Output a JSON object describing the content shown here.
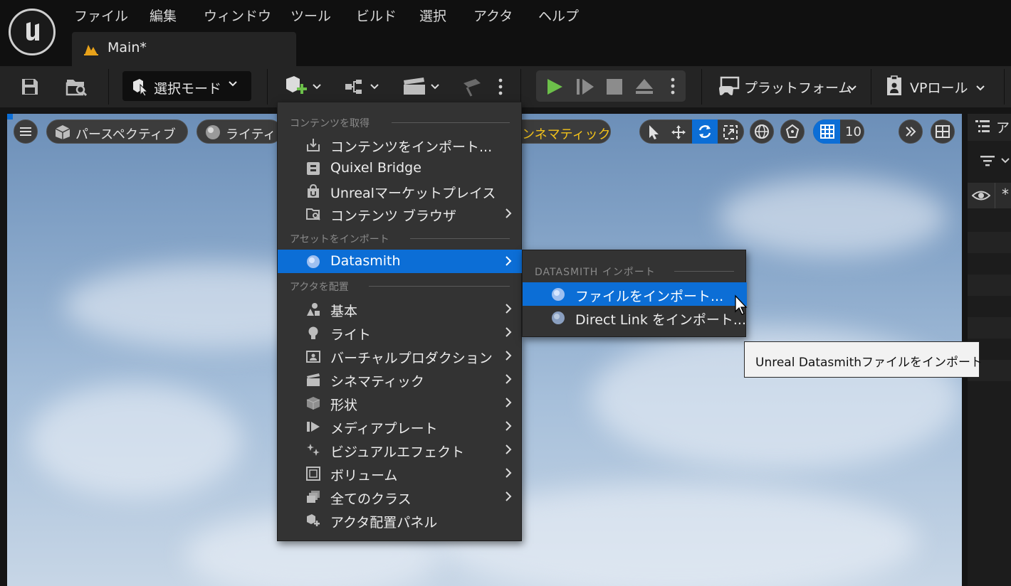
{
  "menubar": {
    "items": [
      "ファイル",
      "編集",
      "ウィンドウ",
      "ツール",
      "ビルド",
      "選択",
      "アクタ",
      "ヘルプ"
    ]
  },
  "document_tab": {
    "label": "Main*"
  },
  "toolbar": {
    "mode_label": "選択モード",
    "platform_label": "プラットフォーム",
    "vp_role_label": "VPロール"
  },
  "viewport": {
    "perspective_label": "パースペクティブ",
    "lighting_label": "ライティ",
    "cinematic_label": "ンネマティック",
    "grid_value": "10"
  },
  "outliner": {
    "header_label": "ア"
  },
  "add_menu": {
    "section_get_content": "コンテンツを取得",
    "import_content": "コンテンツをインポート...",
    "quixel_bridge": "Quixel Bridge",
    "marketplace": "Unrealマーケットプレイス",
    "content_browser": "コンテンツ ブラウザ",
    "section_import_asset": "アセットをインポート",
    "datasmith": "Datasmith",
    "section_place_actor": "アクタを配置",
    "basic": "基本",
    "lights": "ライト",
    "virtual_production": "バーチャルプロダクション",
    "cinematic": "シネマティック",
    "shapes": "形状",
    "media_plate": "メディアプレート",
    "visual_effects": "ビジュアルエフェクト",
    "volumes": "ボリューム",
    "all_classes": "全てのクラス",
    "place_actors_panel": "アクタ配置パネル"
  },
  "datasmith_submenu": {
    "section": "DATASMITH インポート",
    "import_file": "ファイルをインポート...",
    "import_direct_link": "Direct Link をインポート..."
  },
  "tooltip": {
    "text": "Unreal Datasmithファイルをインポート"
  },
  "colors": {
    "accent": "#0c6ed6",
    "play_green": "#6cc04a",
    "cinematic_text": "#f2c21b"
  }
}
